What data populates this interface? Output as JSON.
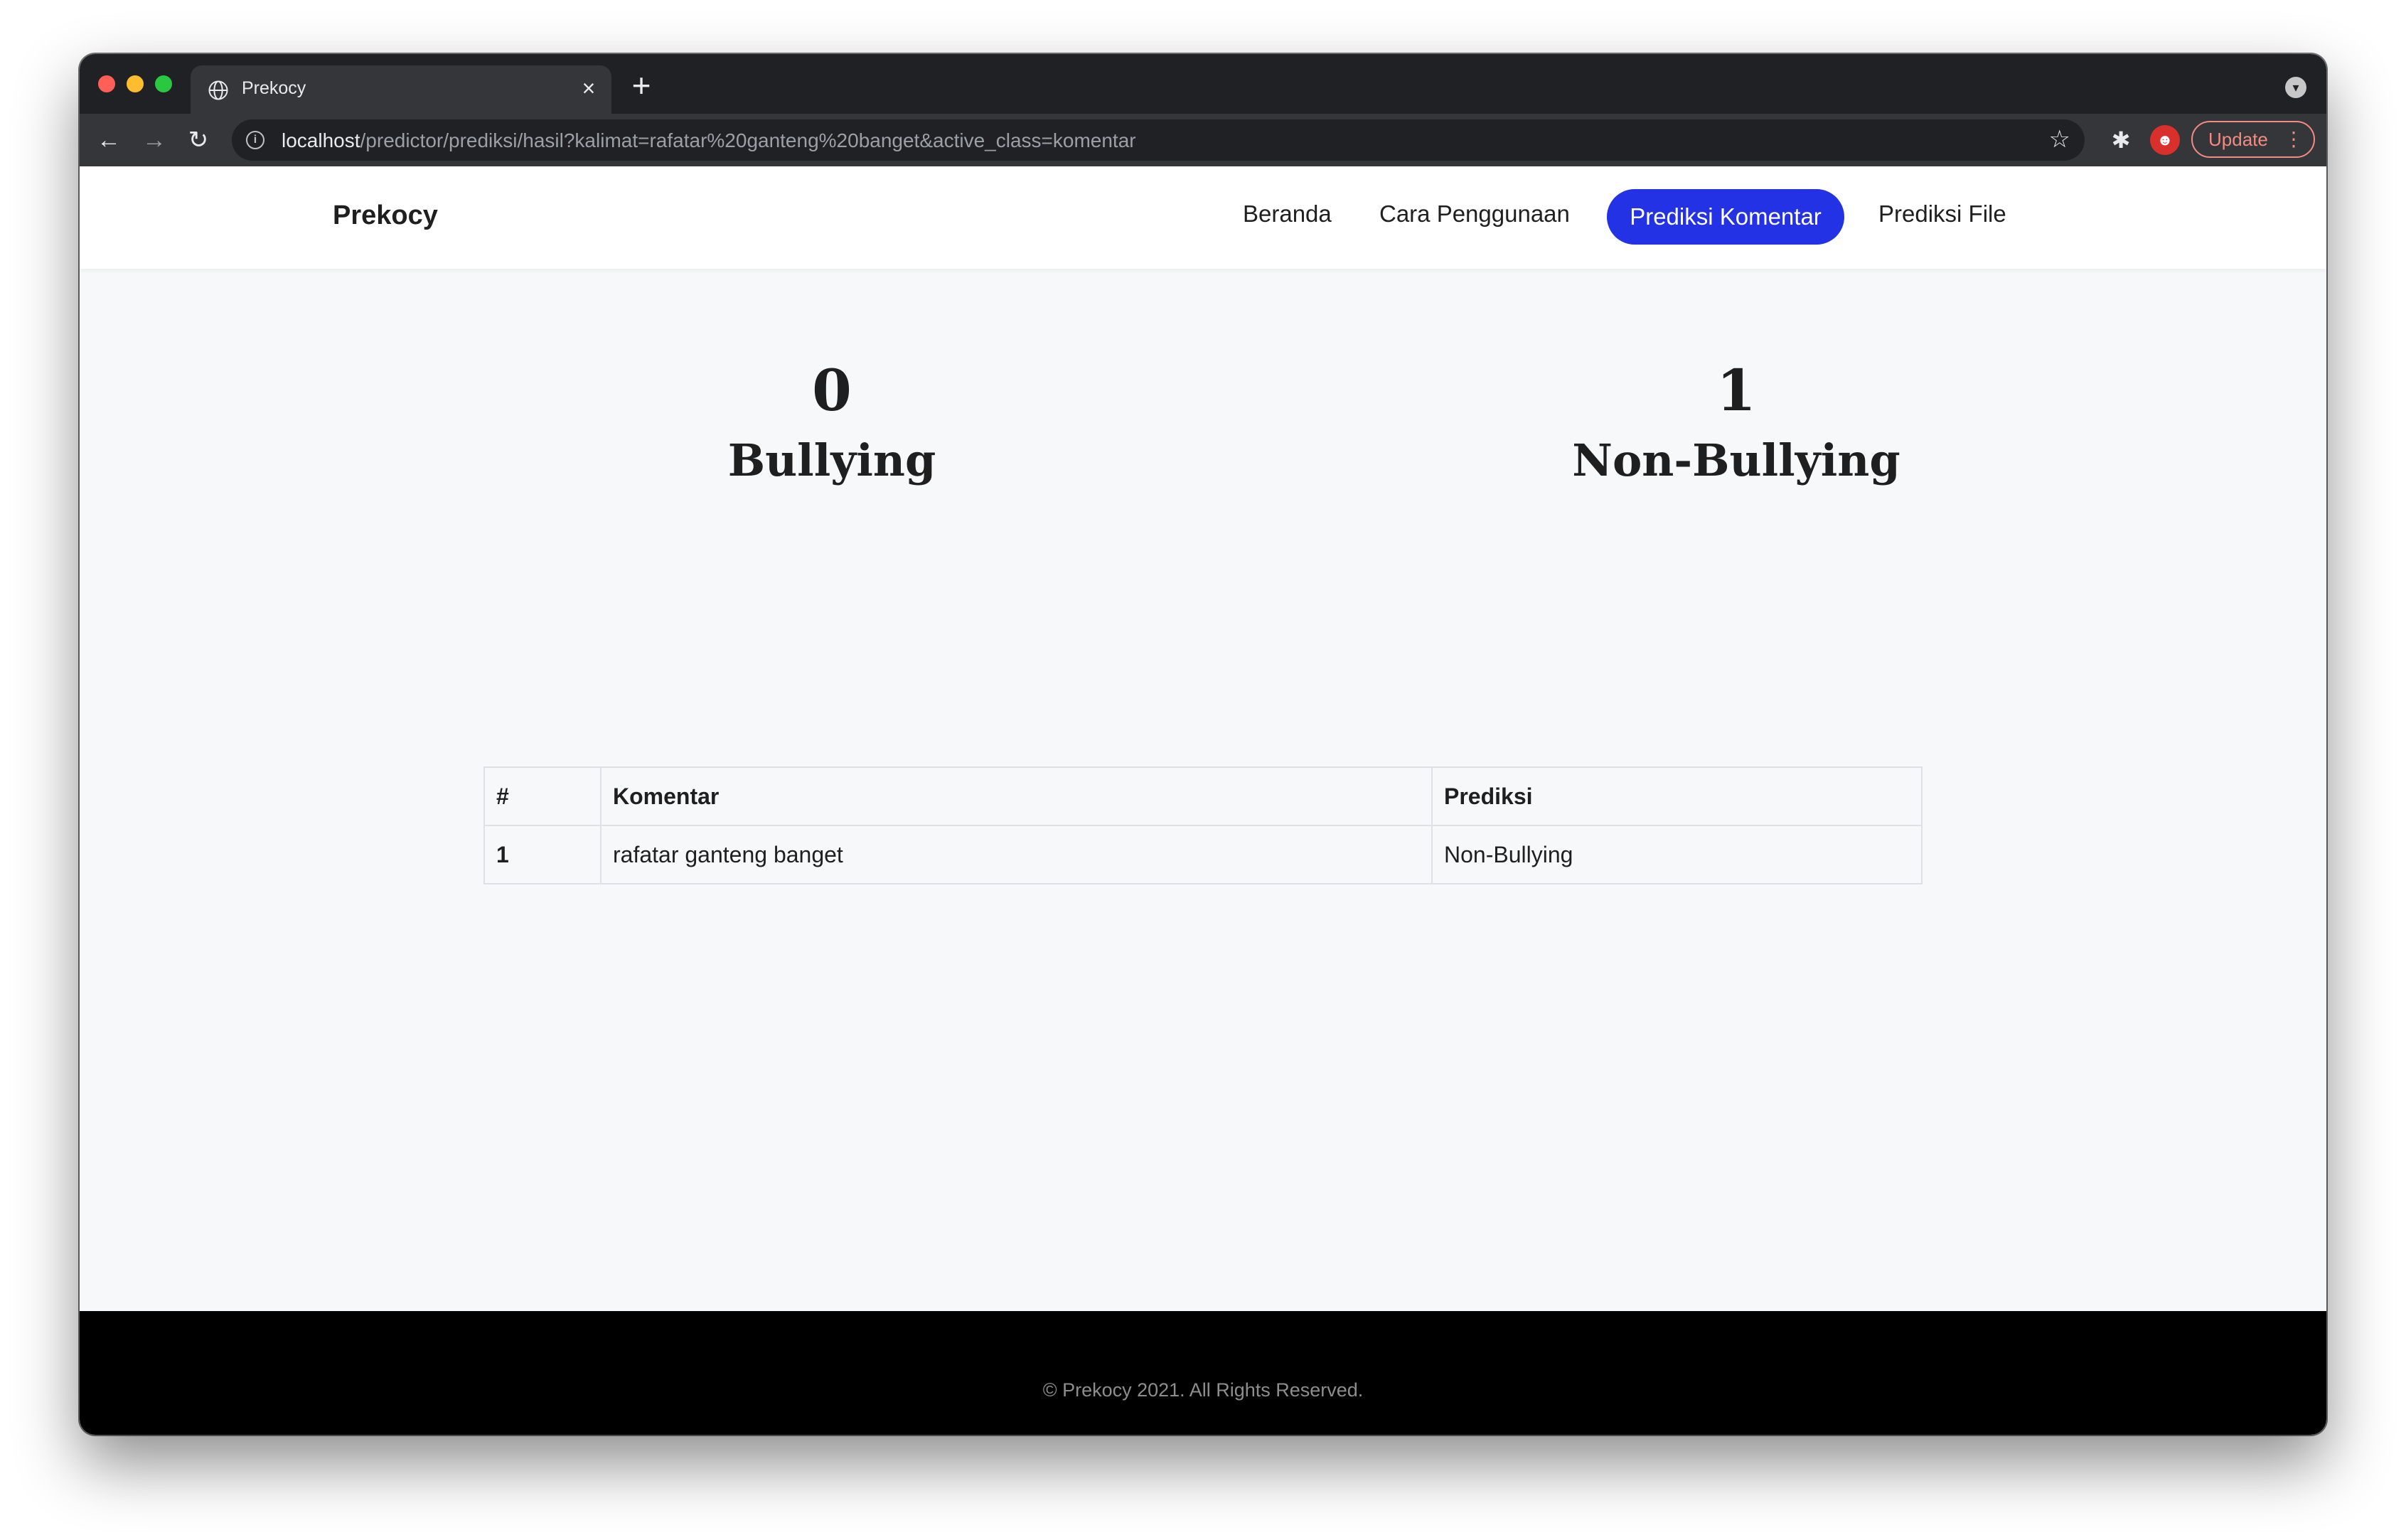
{
  "browser": {
    "tab_title": "Prekocy",
    "tab_close": "×",
    "new_tab": "+",
    "url_host": "localhost",
    "url_path": "/predictor/prediksi/hasil?kalimat=rafatar%20ganteng%20banget&active_class=komentar",
    "update_label": "Update",
    "icons": {
      "back": "back-arrow-icon",
      "forward": "forward-arrow-icon",
      "reload": "reload-icon",
      "info": "info-icon",
      "star": "bookmark-star-icon",
      "extensions": "puzzle-icon",
      "menu": "more-vert-icon"
    }
  },
  "navbar": {
    "brand": "Prekocy",
    "links": [
      {
        "label": "Beranda"
      },
      {
        "label": "Cara Penggunaan"
      },
      {
        "label": "Prediksi Komentar",
        "active": true
      },
      {
        "label": "Prediksi File"
      }
    ],
    "active_color": "#2432e6"
  },
  "stats": [
    {
      "count": "0",
      "label": "Bullying"
    },
    {
      "count": "1",
      "label": "Non-Bullying"
    }
  ],
  "table": {
    "headers": [
      "#",
      "Komentar",
      "Prediksi"
    ],
    "rows": [
      [
        "1",
        "rafatar ganteng banget",
        "Non-Bullying"
      ]
    ]
  },
  "footer": {
    "copyright": "© Prekocy 2021. All Rights Reserved."
  }
}
